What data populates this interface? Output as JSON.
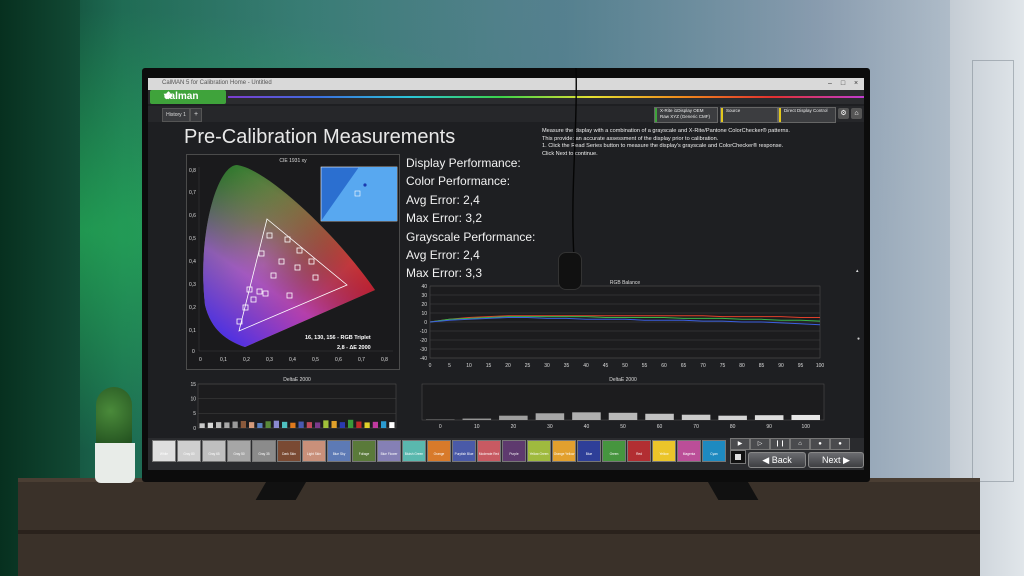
{
  "app": {
    "window_title": "CalMAN 5 for Calibration Home - Untitled",
    "logo": "calman",
    "tab": "History 1",
    "tab_add": "+"
  },
  "toolbar": {
    "meter": "X-Rite i1Display OEM\nRaw XYZ (Generic CMF)",
    "source": "Source",
    "display": "Direct Display Control",
    "colors": {
      "meter": "#3fa33b",
      "source": "#e2c81c",
      "display": "#e2c81c"
    }
  },
  "page": {
    "title": "Pre-Calibration Measurements",
    "instructions": [
      "Measure the display with a combination of a grayscale and X-Rite/Pantone ColorChecker® patterns.",
      "This provide: an accurate assessment of the display prior to calibration.",
      "1. Click the Read Series button to measure the display's grayscale and ColorChecker® response.",
      "Click Next to continue."
    ]
  },
  "performance": {
    "display": "Display Performance:",
    "color": "Color Performance:",
    "color_avg": "Avg Error: 2,4",
    "color_max": "Max Error: 3,2",
    "gray": "Grayscale Performance:",
    "gray_avg": "Avg Error: 2,4",
    "gray_max": "Max Error: 3,3"
  },
  "cie": {
    "title": "CIE 1931 xy",
    "triplet": "16, 130, 156 - RGB Triplet",
    "de": "2,8 - ΔE 2000",
    "x_ticks": [
      "0",
      "0,1",
      "0,2",
      "0,3",
      "0,4",
      "0,5",
      "0,6",
      "0,7",
      "0,8"
    ],
    "y_ticks": [
      "0,8",
      "0,7",
      "0,6",
      "0,5",
      "0,4",
      "0,3",
      "0,2",
      "0,1",
      "0"
    ]
  },
  "chart_data": [
    {
      "type": "line",
      "title": "RGB Balance",
      "x": [
        0,
        5,
        10,
        15,
        20,
        25,
        30,
        35,
        40,
        45,
        50,
        55,
        60,
        65,
        70,
        75,
        80,
        85,
        90,
        95,
        100
      ],
      "ylim": [
        -40,
        40
      ],
      "y_ticks": [
        "40",
        "30",
        "20",
        "10",
        "0",
        "-10",
        "-20",
        "-30",
        "-40"
      ],
      "series": [
        {
          "color": "#e0402a",
          "values": [
            0,
            3,
            5,
            6,
            7,
            7,
            7,
            7,
            7,
            7,
            7,
            7,
            7,
            7,
            7,
            6,
            6,
            6,
            6,
            5,
            5
          ]
        },
        {
          "color": "#38b64a",
          "values": [
            0,
            3,
            4,
            5,
            6,
            6,
            6,
            6,
            6,
            5,
            5,
            5,
            5,
            4,
            4,
            4,
            3,
            3,
            2,
            2,
            1
          ]
        },
        {
          "color": "#3b5fe0",
          "values": [
            0,
            2,
            3,
            4,
            5,
            5,
            4,
            4,
            3,
            3,
            3,
            2,
            2,
            2,
            1,
            1,
            0,
            0,
            -1,
            -2,
            -3
          ]
        }
      ]
    },
    {
      "type": "bar",
      "title": "DeltaE 2000",
      "ylim": [
        0,
        15
      ],
      "y_ticks": [
        "15",
        "10",
        "5",
        "0"
      ],
      "values": [
        1.6,
        1.8,
        2.0,
        1.9,
        2.2,
        2.4,
        2.0,
        1.7,
        2.3,
        2.5,
        2.1,
        1.8,
        2.2,
        2.0,
        1.9,
        2.6,
        2.4,
        2.0,
        2.8,
        2.2,
        1.9,
        2.1,
        2.3,
        2.0
      ],
      "colors": [
        "#c9c9c9",
        "#d7d7d7",
        "#bdbdbd",
        "#a8a8a8",
        "#9a9a9a",
        "#8a5a3c",
        "#d49a7a",
        "#5a7fc0",
        "#5a8a3a",
        "#8a8ad0",
        "#4fc0c0",
        "#e07a1c",
        "#4a5ab0",
        "#c04a5a",
        "#7a3a8a",
        "#a0c03a",
        "#e0a02a",
        "#2a3ab0",
        "#3a9a3a",
        "#c02a2a",
        "#e0d02a",
        "#c03aa0",
        "#2a9ad0",
        "#ffffff"
      ]
    },
    {
      "type": "bar",
      "title": "DeltaE 2000",
      "categories": [
        "0",
        "10",
        "20",
        "30",
        "40",
        "50",
        "60",
        "70",
        "80",
        "90",
        "100"
      ],
      "values": [
        0.2,
        0.6,
        1.8,
        2.8,
        3.2,
        3.0,
        2.6,
        2.2,
        1.8,
        2.0,
        2.1
      ]
    }
  ],
  "swatches": [
    {
      "label": "White",
      "color": "#dedede"
    },
    {
      "label": "Gray 80",
      "color": "#cfcfcf"
    },
    {
      "label": "Gray 65",
      "color": "#bfbfbf"
    },
    {
      "label": "Gray 50",
      "color": "#a6a6a6"
    },
    {
      "label": "Gray 35",
      "color": "#8b8b8b"
    },
    {
      "label": "Dark Skin",
      "color": "#7a4a33"
    },
    {
      "label": "Light Skin",
      "color": "#c9907a"
    },
    {
      "label": "Blue Sky",
      "color": "#5d7ab5"
    },
    {
      "label": "Foliage",
      "color": "#5a7a3a"
    },
    {
      "label": "Blue Flower",
      "color": "#8580b5"
    },
    {
      "label": "Bluish Green",
      "color": "#5ab8ae"
    },
    {
      "label": "Orange",
      "color": "#d87a2a"
    },
    {
      "label": "Purplish Blue",
      "color": "#4a5aa8"
    },
    {
      "label": "Moderate Red",
      "color": "#c85a62"
    },
    {
      "label": "Purple",
      "color": "#5e3a6e"
    },
    {
      "label": "Yellow Green",
      "color": "#9fba3e"
    },
    {
      "label": "Orange Yellow",
      "color": "#e2a02e"
    },
    {
      "label": "Blue",
      "color": "#2e3f98"
    },
    {
      "label": "Green",
      "color": "#46953f"
    },
    {
      "label": "Red",
      "color": "#b22e32"
    },
    {
      "label": "Yellow",
      "color": "#ebc52a"
    },
    {
      "label": "Magenta",
      "color": "#bb4e98"
    },
    {
      "label": "Cyan",
      "color": "#1e8ac0"
    }
  ],
  "nav": {
    "back": "Back",
    "next": "Next"
  }
}
